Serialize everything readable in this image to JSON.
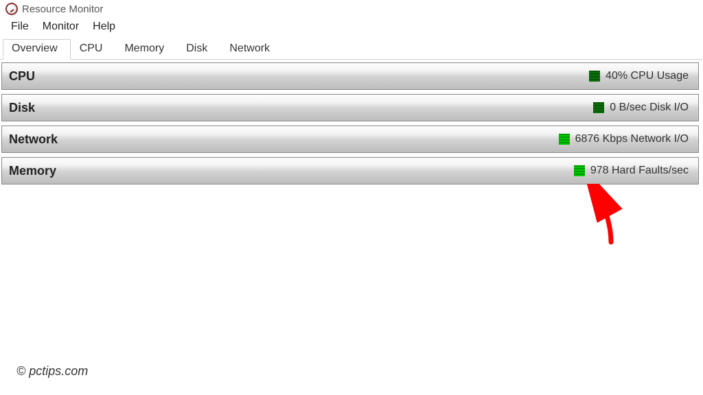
{
  "title": "Resource Monitor",
  "menu": {
    "file": "File",
    "monitor": "Monitor",
    "help": "Help"
  },
  "tabs": {
    "overview": "Overview",
    "cpu": "CPU",
    "memory": "Memory",
    "disk": "Disk",
    "network": "Network"
  },
  "panels": {
    "cpu": {
      "title": "CPU",
      "status": "40% CPU Usage"
    },
    "disk": {
      "title": "Disk",
      "status": "0 B/sec Disk I/O"
    },
    "network": {
      "title": "Network",
      "status": "6876 Kbps Network I/O"
    },
    "memory": {
      "title": "Memory",
      "status": "978 Hard Faults/sec"
    }
  },
  "watermark": "© pctips.com"
}
